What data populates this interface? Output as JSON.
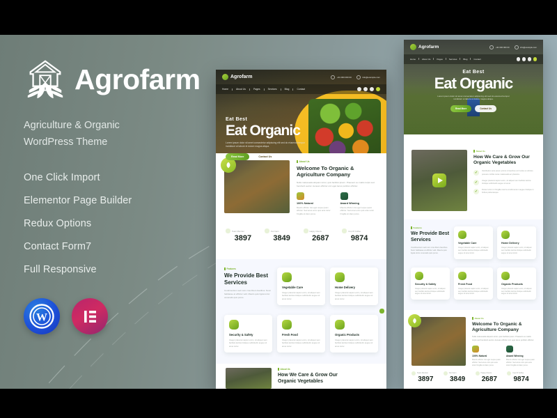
{
  "promo": {
    "brand_name": "Agrofarm",
    "logo_icon": "farm-barn-logo-icon",
    "tagline_line1": "Agriculture & Organic",
    "tagline_line2": "WordPress Theme",
    "features": [
      "One Click Import",
      "Elementor Page Builder",
      "Redux Options",
      "Contact Form7",
      "Full Responsive"
    ],
    "badges": [
      {
        "name": "wordpress-logo-icon",
        "glyph": "W"
      },
      {
        "name": "elementor-logo-icon",
        "glyph": "E"
      }
    ]
  },
  "colors": {
    "bg_left": "#6e7d77",
    "bg_right": "#9fb4bb",
    "accent_green": "#7db52e",
    "accent_yellow": "#f6c026",
    "heading_dark": "#1d2d24",
    "wordpress_blue": "#1d4fd8",
    "elementor_pink": "#cf2a62"
  },
  "site": {
    "logo_text": "Agrofarm",
    "nav": [
      "Home",
      "About Us",
      "Pages",
      "Services",
      "Blog",
      "Contact"
    ],
    "contact": [
      {
        "icon": "phone-icon",
        "text": "+91 000 000 00"
      },
      {
        "icon": "envelope-icon",
        "text": "info@example.com"
      }
    ],
    "hero": {
      "subtitle": "Eat Best",
      "title": "Eat Organic",
      "paragraph": "Lorem ipsum dolor sit amet consectetur adipiscing elit sed do eiusmod tempor incididunt ut labore et dolore magna aliqua.",
      "primary_button": "Read More",
      "secondary_button": "Contact Us"
    },
    "about": {
      "tag": "About Us",
      "title_line1": "Welcome To Organic &",
      "title_line2": "Agriculture Company",
      "paragraph": "Nulla malesuada aliquam tortor, quis facilisis ipsum. Praesent eu mattis turpis sed hendrerit auctor. Aenean efficitur orci eget lacus porttitor efficitur.",
      "features": [
        {
          "icon": "crate-icon",
          "title": "100% Natural",
          "text": "Mauris efficitur nisi eget neque quam efficitur. Sed amet enim quis ante tortor fringilla sit diam purus."
        },
        {
          "icon": "award-ribbon-icon",
          "title": "Award Winning",
          "text": "Mauris efficitur nisi eget neque quam efficitur. Sed amet enim quis ante tortor fringilla sit diam purus."
        }
      ]
    },
    "stats": [
      {
        "icon": "team-icon",
        "label": "Team Member",
        "value": "3897"
      },
      {
        "icon": "plant-icon",
        "label": "Our Farm",
        "value": "3849"
      },
      {
        "icon": "clients-icon",
        "label": "Happy Clients",
        "value": "2687"
      },
      {
        "icon": "coffee-icon",
        "label": "Cup Of Coffee",
        "value": "9874"
      }
    ],
    "services": {
      "tag": "Features",
      "title_line1": "We Provide Best",
      "title_line2": "Services",
      "paragraph": "Condimentum sed nunc cras libero faucibus. Nunc habitasse at efficitur velit. Mauris quis ligula tortor venenatis quis purus.",
      "cards": [
        {
          "icon": "vegetable-icon",
          "title": "Vegetable Care",
          "text": "Integer placerat sapien enim, sit aliquet sem facilisis lacinia tristique sollicitudin augue sit amet tortor."
        },
        {
          "icon": "delivery-truck-icon",
          "title": "Home Delivery",
          "text": "Integer placerat sapien enim, sit aliquet sem facilisis lacinia tristique sollicitudin augue sit amet tortor."
        },
        {
          "icon": "shield-icon",
          "title": "Security & Safety",
          "text": "Integer placerat sapien enim, sit aliquet sem facilisis lacinia tristique sollicitudin augue sit amet tortor."
        },
        {
          "icon": "apple-icon",
          "title": "Fresh Food",
          "text": "Integer placerat sapien enim, sit aliquet sem facilisis lacinia tristique sollicitudin augue sit amet tortor."
        },
        {
          "icon": "leaf-badge-icon",
          "title": "Organic Products",
          "text": "Integer placerat sapien enim, sit aliquet sem facilisis lacinia tristique sollicitudin augue sit amet tortor."
        }
      ]
    },
    "care": {
      "tag": "About Us",
      "title_line1": "How We Care & Grow Our",
      "title_line2": "Organic Vegetables",
      "play_button": "play-video-icon",
      "checks": [
        "Vestibulum ante ipsum primis in faucibus orci luctus et ultrices posuere cubilia curae malesuada ac pharetra.",
        "Integer placerat sapien enim, sit aliquet sem facilisis lacinia tristique sollicitudin augue sit amet.",
        "Donec tortor mi fringilla viverra condimentum augue tristique in finibus pellentesque."
      ]
    },
    "scroll_top_button": "scroll-to-top-icon"
  }
}
